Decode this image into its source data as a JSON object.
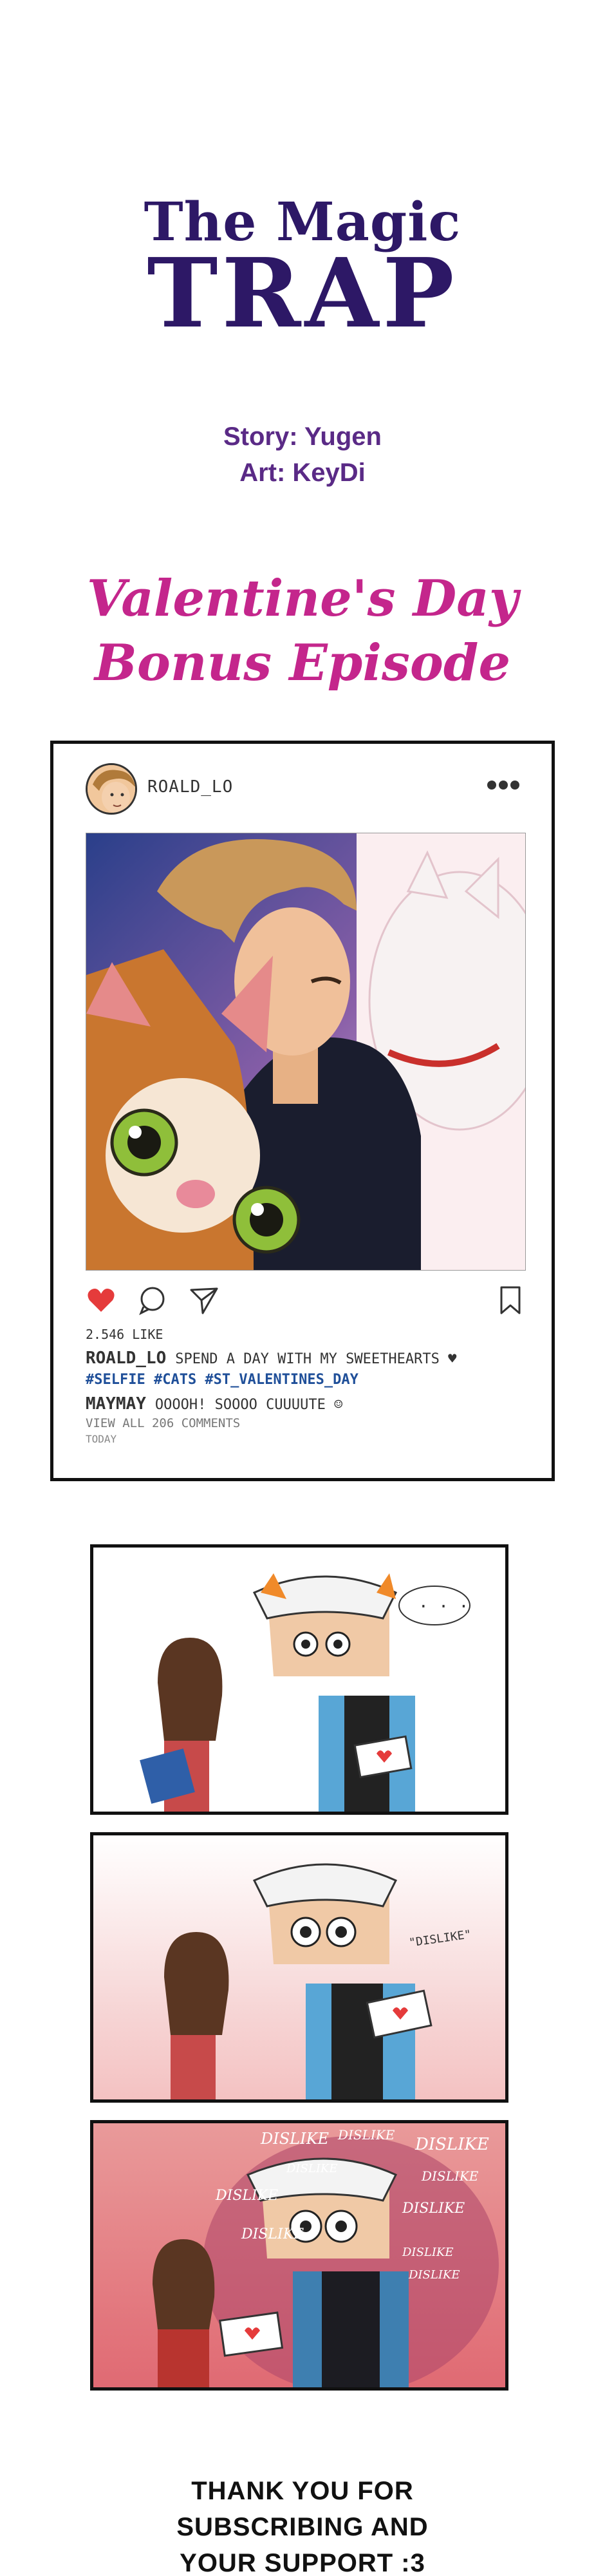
{
  "title": {
    "line1": "The Magic",
    "line2": "TRAP"
  },
  "credits": {
    "story": "Story: Yugen",
    "art": "Art: KeyDi"
  },
  "episode": {
    "line1": "Valentine's Day",
    "line2": "Bonus Episode"
  },
  "post": {
    "username": "ROALD_LO",
    "likes": "2.546 LIKE",
    "caption_user": "ROALD_LO",
    "caption_text": "SPEND A DAY WITH MY SWEETHEARTS ♥",
    "tags": "#SELFIE #CATS #ST_VALENTINES_DAY",
    "comment_user": "MAYMAY",
    "comment_text": "OOOOH! SOOOO CUUUUTE ☺",
    "view_all": "VIEW ALL 206 COMMENTS",
    "time": "TODAY"
  },
  "panels": {
    "p1_sound": ". . .",
    "p2_sound": "\"DISLIKE\"",
    "p3_words": [
      "DISLIKE",
      "DISLIKE",
      "DISLIKE",
      "DISLIKE",
      "DISLIKE",
      "DISLIKE",
      "DISLIKE",
      "DISLIKE",
      "DISLIKE",
      "DISLIKE"
    ]
  },
  "thanks": {
    "line1": "THANK YOU FOR",
    "line2": "SUBSCRIBING AND",
    "line3": "YOUR SUPPORT :3"
  },
  "colors": {
    "title": "#2d1866",
    "credits": "#5a2a86",
    "episode": "#c4268c",
    "heart": "#e53b3b",
    "tags": "#1f4f99"
  },
  "icons": [
    "avatar",
    "more-icon",
    "heart-icon",
    "comment-icon",
    "share-icon",
    "bookmark-icon"
  ]
}
